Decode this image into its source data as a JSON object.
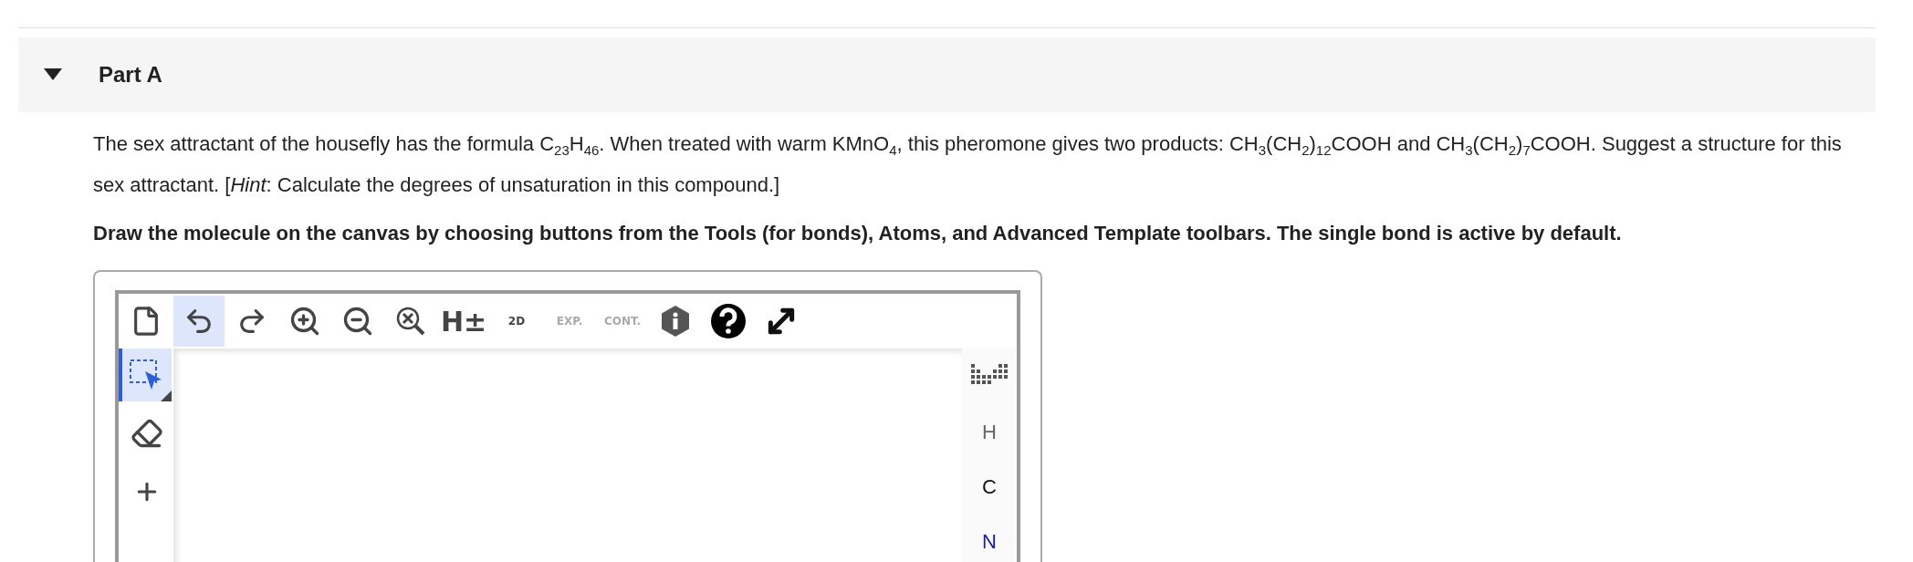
{
  "part": {
    "title": "Part A",
    "expanded": true
  },
  "question": "The sex attractant of the housefly has the formula C$_{23}$H$_{46}$. When treated with warm KMnO$_{4}$, this pheromone gives two products: CH$_{3}$(CH$_{2}$)$_{12}$COOH and CH$_{3}$(CH$_{2}$)$_{7}$COOH. Suggest a structure for this sex attractant. [*Hint*: Calculate the degrees of unsaturation in this compound.]",
  "instruction": "Draw the molecule on the canvas by choosing buttons from the Tools (for bonds), Atoms, and Advanced Template toolbars. The single bond is active by default.",
  "toolbar": [
    {
      "kind": "new",
      "selected": false
    },
    {
      "kind": "undo",
      "selected": true
    },
    {
      "kind": "redo",
      "selected": false
    },
    {
      "kind": "zoom-in",
      "selected": false
    },
    {
      "kind": "zoom-out",
      "selected": false
    },
    {
      "kind": "zoom-reset",
      "selected": false
    },
    {
      "kind": "hydrogens",
      "label": "H±",
      "selected": false
    },
    {
      "kind": "clean",
      "label": "2D",
      "selected": false
    },
    {
      "kind": "expand",
      "label": "EXP.",
      "disabled": true,
      "selected": false
    },
    {
      "kind": "contract",
      "label": "CONT.",
      "disabled": true,
      "selected": false
    },
    {
      "kind": "info",
      "selected": false
    },
    {
      "kind": "help",
      "selected": false
    },
    {
      "kind": "fullscreen",
      "selected": false
    }
  ],
  "tools": [
    {
      "kind": "select",
      "selected": true
    },
    {
      "kind": "erase",
      "selected": false
    },
    {
      "kind": "charge",
      "selected": false
    }
  ],
  "atoms": [
    {
      "kind": "table"
    },
    {
      "kind": "atom",
      "label": "H",
      "color": "#666666"
    },
    {
      "kind": "atom",
      "label": "C",
      "color": "#111111"
    },
    {
      "kind": "atom",
      "label": "N",
      "color": "#1a1ab8"
    }
  ]
}
